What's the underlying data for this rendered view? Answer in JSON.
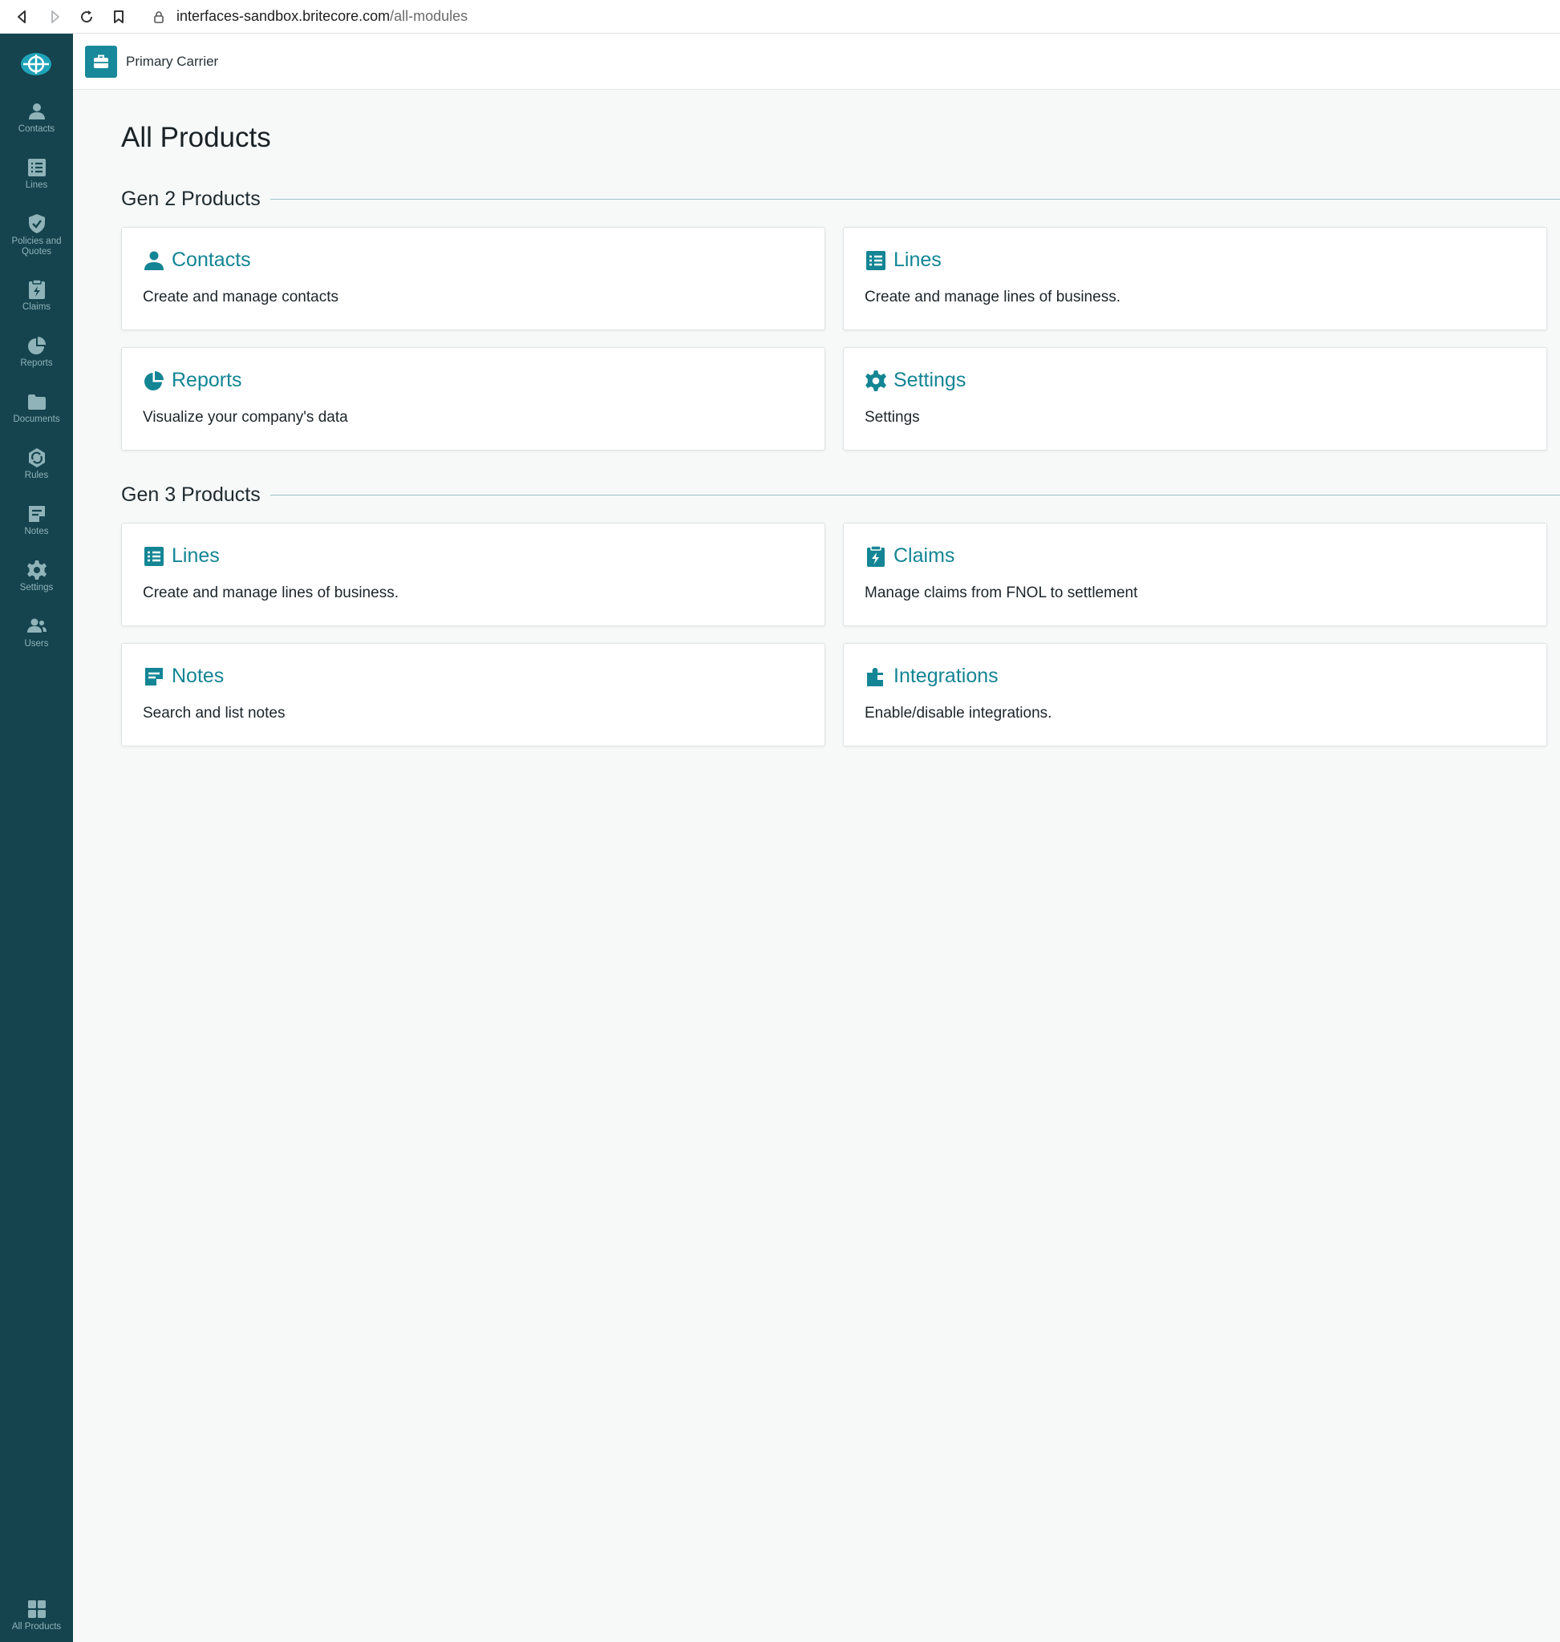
{
  "browser": {
    "url_host": "interfaces-sandbox.britecore.com",
    "url_path": "/all-modules"
  },
  "sidebar": {
    "items": [
      {
        "label": "Contacts",
        "icon": "person-icon"
      },
      {
        "label": "Lines",
        "icon": "list-icon"
      },
      {
        "label": "Policies and Quotes",
        "icon": "shield-check-icon"
      },
      {
        "label": "Claims",
        "icon": "clipboard-bolt-icon"
      },
      {
        "label": "Reports",
        "icon": "pie-chart-icon"
      },
      {
        "label": "Documents",
        "icon": "folder-icon"
      },
      {
        "label": "Rules",
        "icon": "rules-icon"
      },
      {
        "label": "Notes",
        "icon": "note-icon"
      },
      {
        "label": "Settings",
        "icon": "gear-icon"
      },
      {
        "label": "Users",
        "icon": "users-icon"
      }
    ],
    "bottom_item": {
      "label": "All Products",
      "icon": "grid-icon"
    }
  },
  "header": {
    "carrier": "Primary Carrier"
  },
  "page": {
    "title": "All Products",
    "sections": [
      {
        "title": "Gen 2 Products",
        "cards": [
          {
            "title": "Contacts",
            "description": "Create and manage contacts",
            "icon": "person-icon"
          },
          {
            "title": "Lines",
            "description": "Create and manage lines of business.",
            "icon": "list-icon"
          },
          {
            "title": "Reports",
            "description": "Visualize your company's data",
            "icon": "pie-chart-icon"
          },
          {
            "title": "Settings",
            "description": "Settings",
            "icon": "gear-icon"
          }
        ]
      },
      {
        "title": "Gen 3 Products",
        "cards": [
          {
            "title": "Lines",
            "description": "Create and manage lines of business.",
            "icon": "list-icon"
          },
          {
            "title": "Claims",
            "description": "Manage claims from FNOL to settlement",
            "icon": "clipboard-bolt-icon"
          },
          {
            "title": "Notes",
            "description": "Search and list notes",
            "icon": "note-icon"
          },
          {
            "title": "Integrations",
            "description": "Enable/disable integrations.",
            "icon": "puzzle-icon"
          }
        ]
      }
    ]
  },
  "colors": {
    "sidebar_bg": "#15444f",
    "accent": "#138594",
    "page_bg": "#f7f9f9"
  }
}
